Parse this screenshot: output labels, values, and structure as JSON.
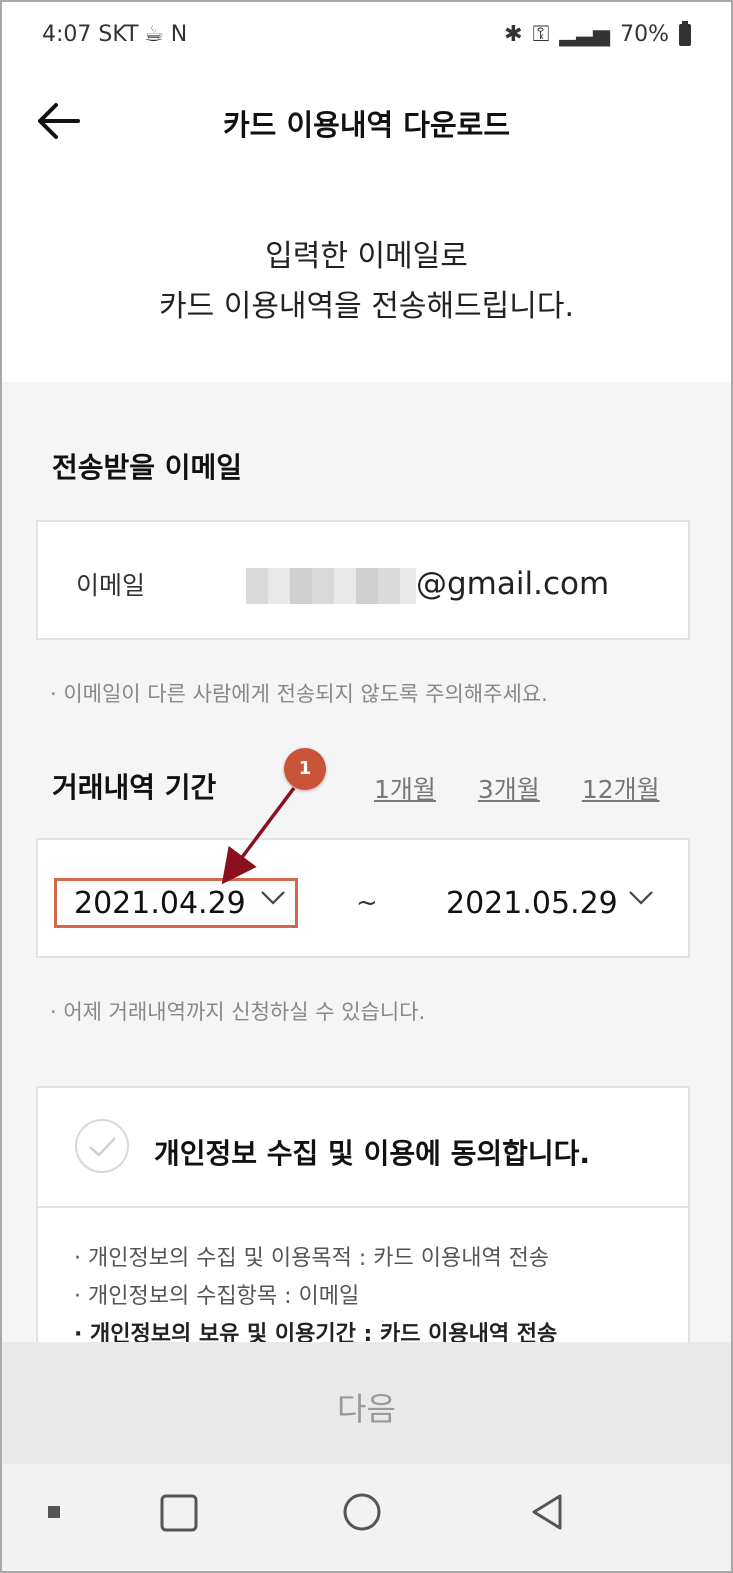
{
  "status_bar": {
    "time": "4:07 SKT",
    "left_icons": "☕ N",
    "battery": "70%"
  },
  "header": {
    "title": "카드 이용내역 다운로드"
  },
  "intro": {
    "line1": "입력한 이메일로",
    "line2": "카드 이용내역을 전송해드립니다."
  },
  "email_section": {
    "title": "전송받을 이메일",
    "field_label": "이메일",
    "email_domain": "@gmail.com",
    "note": "· 이메일이 다른 사람에게 전송되지 않도록 주의해주세요."
  },
  "period_section": {
    "title": "거래내역 기간",
    "links": [
      "1개월",
      "3개월",
      "12개월"
    ],
    "start_date": "2021.04.29",
    "separator": "~",
    "end_date": "2021.05.29",
    "note": "· 어제 거래내역까지 신청하실 수 있습니다."
  },
  "agreement": {
    "title": "개인정보 수집 및 이용에 동의합니다.",
    "items": [
      "· 개인정보의 수집 및 이용목적 :  카드 이용내역 전송",
      "· 개인정보의 수집항목 : 이메일",
      "· 개인정보의 보유 및 이용기간 : 카드 이용내역 전송"
    ]
  },
  "next_button": {
    "label": "다음"
  },
  "annotation": {
    "marker": "1",
    "color": "#c9543a"
  },
  "navbar": {
    "icons": [
      "recent-apps-icon",
      "home-icon",
      "back-icon"
    ]
  }
}
